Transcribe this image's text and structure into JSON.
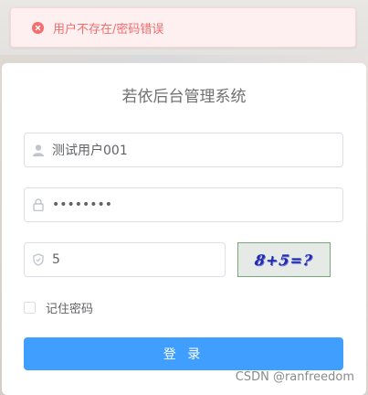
{
  "alert": {
    "message": "用户不存在/密码错误",
    "icon": "error-circle-icon",
    "color": "#f56c6c"
  },
  "login": {
    "title": "若依后台管理系统",
    "username": {
      "value": "测试用户001",
      "icon": "user-icon"
    },
    "password": {
      "value": "••••••••",
      "icon": "lock-icon"
    },
    "code": {
      "value": "5",
      "icon": "shield-icon"
    },
    "captcha_text": "8+5=?",
    "remember_label": "记住密码",
    "submit_label": "登 录",
    "accent": "#409eff"
  },
  "watermark": "CSDN @ranfreedom"
}
